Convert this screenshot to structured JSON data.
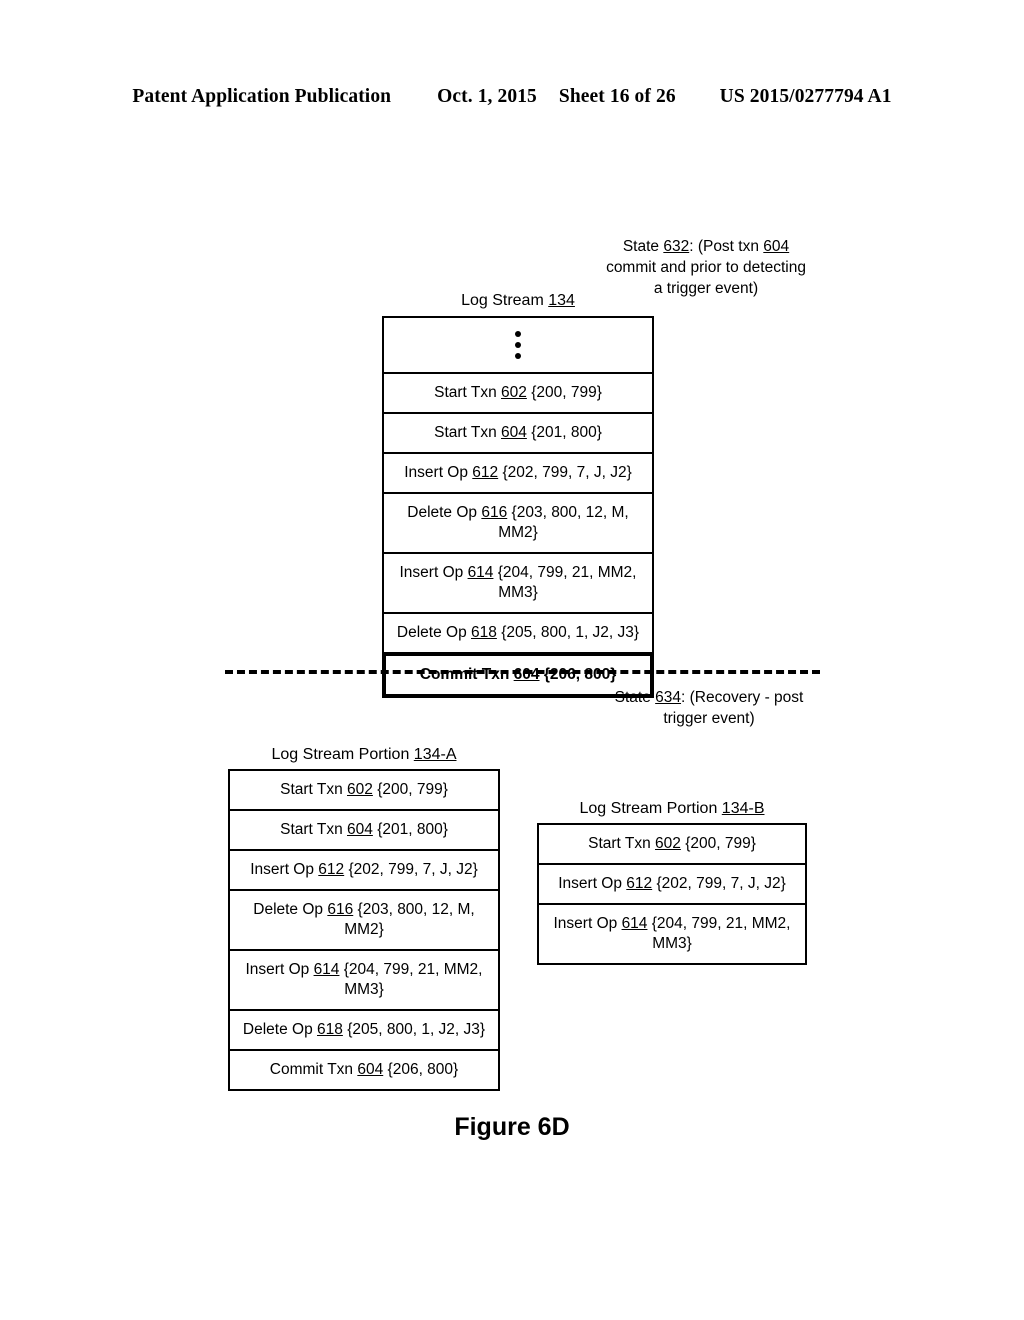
{
  "header": {
    "publication": "Patent Application Publication",
    "date": "Oct. 1, 2015",
    "sheet": "Sheet 16 of 26",
    "patent_number": "US 2015/0277794 A1"
  },
  "figure": {
    "caption": "Figure 6D"
  },
  "state_632": {
    "line1_prefix": "State ",
    "line1_ref": "632",
    "line1_mid": ": (Post txn ",
    "line1_ref2": "604",
    "line2": "commit and prior to detecting",
    "line3": "a trigger event)"
  },
  "state_634": {
    "line1_prefix": "State ",
    "line1_ref": "634",
    "line1_suffix": ": (Recovery - post",
    "line2": "trigger event)"
  },
  "log_stream": {
    "caption_prefix": "Log Stream ",
    "caption_ref": "134",
    "rows": [
      {
        "type": "ellipsis",
        "text": ""
      },
      {
        "type": "entry",
        "label": "Start Txn ",
        "ref": "602",
        "args": " {200, 799}",
        "bold": false
      },
      {
        "type": "entry",
        "label": "Start Txn ",
        "ref": "604",
        "args": " {201, 800}",
        "bold": false
      },
      {
        "type": "entry",
        "label": "Insert Op ",
        "ref": "612",
        "args": " {202, 799, 7, J, J2}",
        "bold": false
      },
      {
        "type": "entry",
        "label": "Delete Op ",
        "ref": "616",
        "args": " {203, 800, 12, M, MM2}",
        "bold": false
      },
      {
        "type": "entry",
        "label": "Insert Op ",
        "ref": "614",
        "args": " {204, 799, 21, MM2, MM3}",
        "bold": false
      },
      {
        "type": "entry",
        "label": "Delete Op ",
        "ref": "618",
        "args": " {205, 800, 1, J2, J3}",
        "bold": false
      },
      {
        "type": "entry",
        "label": "Commit Txn ",
        "ref": "604",
        "args": " {206, 800}",
        "bold": true
      }
    ]
  },
  "log_stream_portion_a": {
    "caption_prefix": "Log Stream Portion ",
    "caption_ref": "134-A",
    "rows": [
      {
        "label": "Start Txn ",
        "ref": "602",
        "args": " {200, 799}"
      },
      {
        "label": "Start Txn ",
        "ref": "604",
        "args": " {201, 800}"
      },
      {
        "label": "Insert Op ",
        "ref": "612",
        "args": " {202, 799, 7, J, J2}"
      },
      {
        "label": "Delete Op ",
        "ref": "616",
        "args": " {203, 800, 12, M, MM2}"
      },
      {
        "label": "Insert Op ",
        "ref": "614",
        "args": " {204, 799, 21, MM2, MM3}"
      },
      {
        "label": "Delete Op ",
        "ref": "618",
        "args": " {205, 800, 1, J2, J3}"
      },
      {
        "label": "Commit Txn ",
        "ref": "604",
        "args": " {206, 800}"
      }
    ]
  },
  "log_stream_portion_b": {
    "caption_prefix": "Log Stream Portion ",
    "caption_ref": "134-B",
    "rows": [
      {
        "label": "Start Txn ",
        "ref": "602",
        "args": " {200, 799}"
      },
      {
        "label": "Insert Op ",
        "ref": "612",
        "args": " {202, 799, 7, J, J2}"
      },
      {
        "label": "Insert Op ",
        "ref": "614",
        "args": " {204, 799, 21, MM2, MM3}"
      }
    ]
  }
}
